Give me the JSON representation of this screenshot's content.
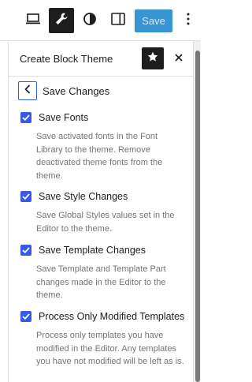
{
  "toolbar": {
    "icons": [
      "desktop-icon",
      "wrench-icon",
      "contrast-icon",
      "sidebar-icon",
      "more-vertical-icon"
    ],
    "active_icon": "wrench-icon",
    "save_label": "Save"
  },
  "panel": {
    "title": "Create Block Theme",
    "back_label": "Save Changes",
    "options": [
      {
        "label": "Save Fonts",
        "checked": true,
        "help": "Save activated fonts in the Font Library to the theme. Remove deactivated theme fonts from the theme."
      },
      {
        "label": "Save Style Changes",
        "checked": true,
        "help": "Save Global Styles values set in the Editor to the theme."
      },
      {
        "label": "Save Template Changes",
        "checked": true,
        "help": "Save Template and Template Part changes made in the Editor to the theme."
      },
      {
        "label": "Process Only Modified Templates",
        "checked": true,
        "help": "Process only templates you have modified in the Editor. Any templates you have not modified will be left as is."
      }
    ]
  },
  "colors": {
    "accent": "#3858e9",
    "save_button": "#3895d3",
    "help_text": "#757575"
  }
}
